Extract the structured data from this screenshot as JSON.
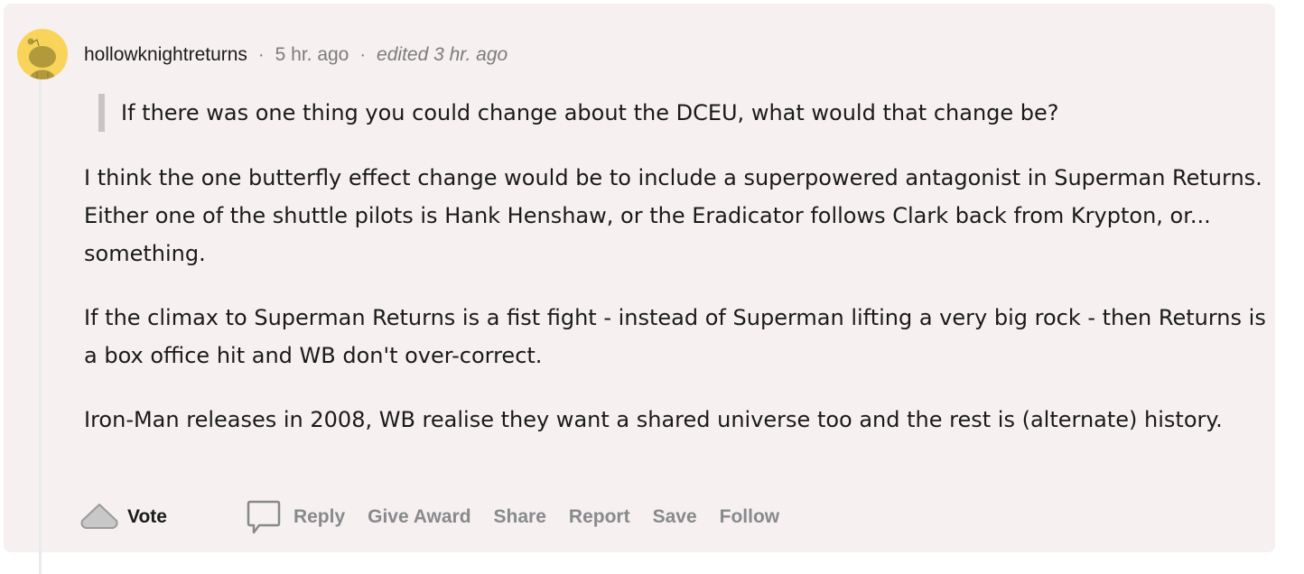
{
  "comment": {
    "username": "hollowknightreturns",
    "separator": "·",
    "time_posted": "5 hr. ago",
    "edited": "edited 3 hr. ago",
    "avatar_icon": "reddit-snoo-avatar",
    "colors": {
      "card_background": "#f6f0f0",
      "avatar_background": "#f8d55a",
      "quote_bar": "#c9c5c5",
      "action_text": "#878a8c"
    },
    "quote": "If there was one thing you could change about the DCEU, what would that change be?",
    "paragraphs": [
      "I think the one butterfly effect change would be to include a superpowered antagonist in Superman Returns. Either one of the shuttle pilots is Hank Henshaw, or the Eradicator follows Clark back from Krypton, or... something.",
      "If the climax to Superman Returns is a fist fight - instead of Superman lifting a very big rock - then Returns is a box office hit and WB don't over-correct.",
      "Iron-Man releases in 2008, WB realise they want a shared universe too and the rest is (alternate) history."
    ]
  },
  "actions": {
    "vote_label": "Vote",
    "reply_label": "Reply",
    "give_award_label": "Give Award",
    "share_label": "Share",
    "report_label": "Report",
    "save_label": "Save",
    "follow_label": "Follow"
  }
}
